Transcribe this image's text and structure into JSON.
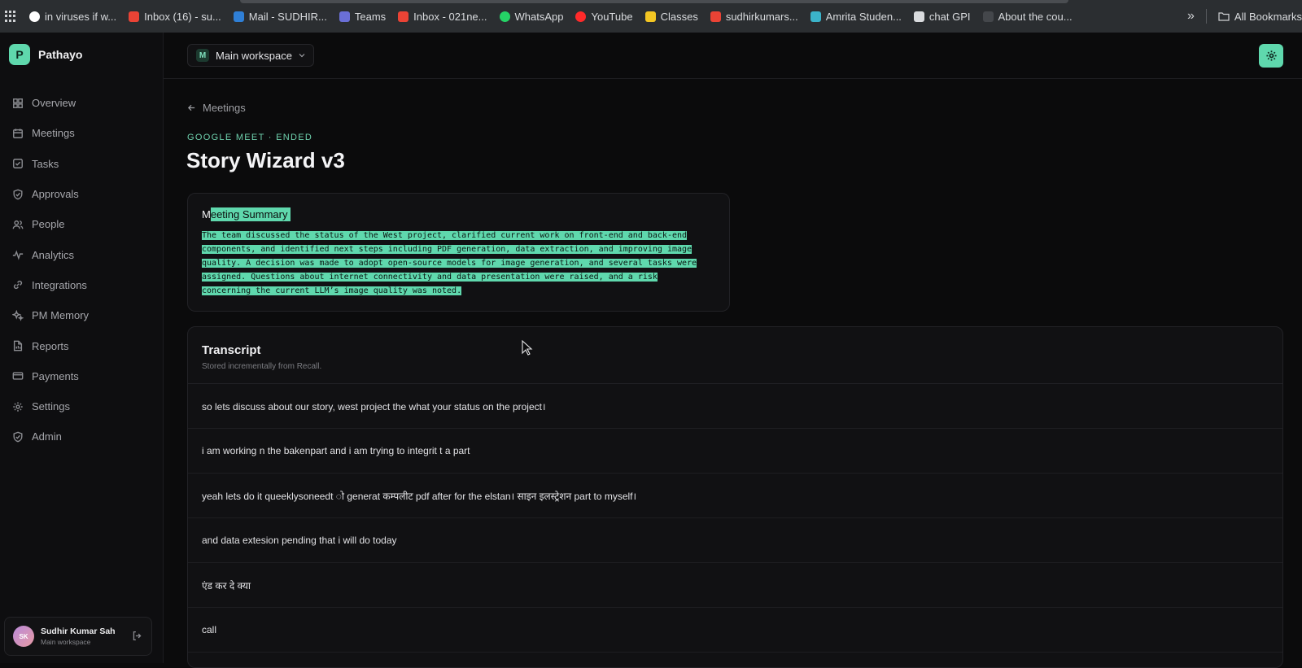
{
  "bookmarks": [
    {
      "label": "in viruses if w...",
      "color": "#ffffff"
    },
    {
      "label": "Inbox (16) - su...",
      "color": "#ea4335"
    },
    {
      "label": "Mail - SUDHIR...",
      "color": "#2f7fd6"
    },
    {
      "label": "Teams",
      "color": "#6a6fd6"
    },
    {
      "label": "Inbox - 021ne...",
      "color": "#ea4335"
    },
    {
      "label": "WhatsApp",
      "color": "#25d366"
    },
    {
      "label": "YouTube",
      "color": "#ff2a2a"
    },
    {
      "label": "Classes",
      "color": "#f3c623"
    },
    {
      "label": "sudhirkumars...",
      "color": "#ea4335"
    },
    {
      "label": "Amrita Studen...",
      "color": "#3bb3c9"
    },
    {
      "label": "chat GPI",
      "color": "#d9dbde"
    },
    {
      "label": "About the cou...",
      "color": "#44474b"
    }
  ],
  "bookmarks_more": "»",
  "all_bookmarks": "All Bookmarks",
  "brand": {
    "logo": "P",
    "name": "Pathayo"
  },
  "nav": [
    {
      "label": "Overview",
      "icon": "grid-icon"
    },
    {
      "label": "Meetings",
      "icon": "calendar-icon"
    },
    {
      "label": "Tasks",
      "icon": "checkbox-icon"
    },
    {
      "label": "Approvals",
      "icon": "shield-check-icon"
    },
    {
      "label": "People",
      "icon": "users-icon"
    },
    {
      "label": "Analytics",
      "icon": "pulse-icon"
    },
    {
      "label": "Integrations",
      "icon": "link-icon"
    },
    {
      "label": "PM Memory",
      "icon": "sparkles-icon"
    },
    {
      "label": "Reports",
      "icon": "file-chart-icon"
    },
    {
      "label": "Payments",
      "icon": "card-icon"
    },
    {
      "label": "Settings",
      "icon": "gear-icon"
    },
    {
      "label": "Admin",
      "icon": "shield-icon"
    }
  ],
  "user": {
    "initials": "SK",
    "name": "Sudhir Kumar Sah",
    "workspace": "Main workspace"
  },
  "workspace": {
    "badge": "M",
    "label": "Main workspace"
  },
  "page": {
    "back_label": "Meetings",
    "kicker": "GOOGLE MEET · ENDED",
    "title": "Story Wizard v3"
  },
  "summary": {
    "heading_first": "M",
    "heading_rest": "eeting Summary",
    "lines": [
      "The team discussed the status of the West project, clarified current work on front-end and back-end",
      "components, and identified next steps including PDF generation, data extraction, and improving image",
      "quality. A decision was made to adopt open-source models for image generation, and several tasks were",
      "assigned. Questions about internet connectivity and data presentation were raised, and a risk",
      "concerning the current LLM’s image quality was noted."
    ]
  },
  "transcript": {
    "title": "Transcript",
    "subtitle": "Stored incrementally from Recall.",
    "rows": [
      "so lets discuss about our story, west project the what your status on the project।",
      "i am working n the bakenpart and i am trying to integrit t a part",
      "yeah lets do it queeklysoneedt ो generat कम्पलीट pdf after for the elstan। साइन इलस्ट्रेशन part to myself।",
      "and data extesion pending that i will do today",
      "एंड कर दे क्या",
      "call",
      ""
    ]
  },
  "colors": {
    "accent": "#5fd8ad",
    "background": "#0b0b0c",
    "card": "#111113"
  }
}
